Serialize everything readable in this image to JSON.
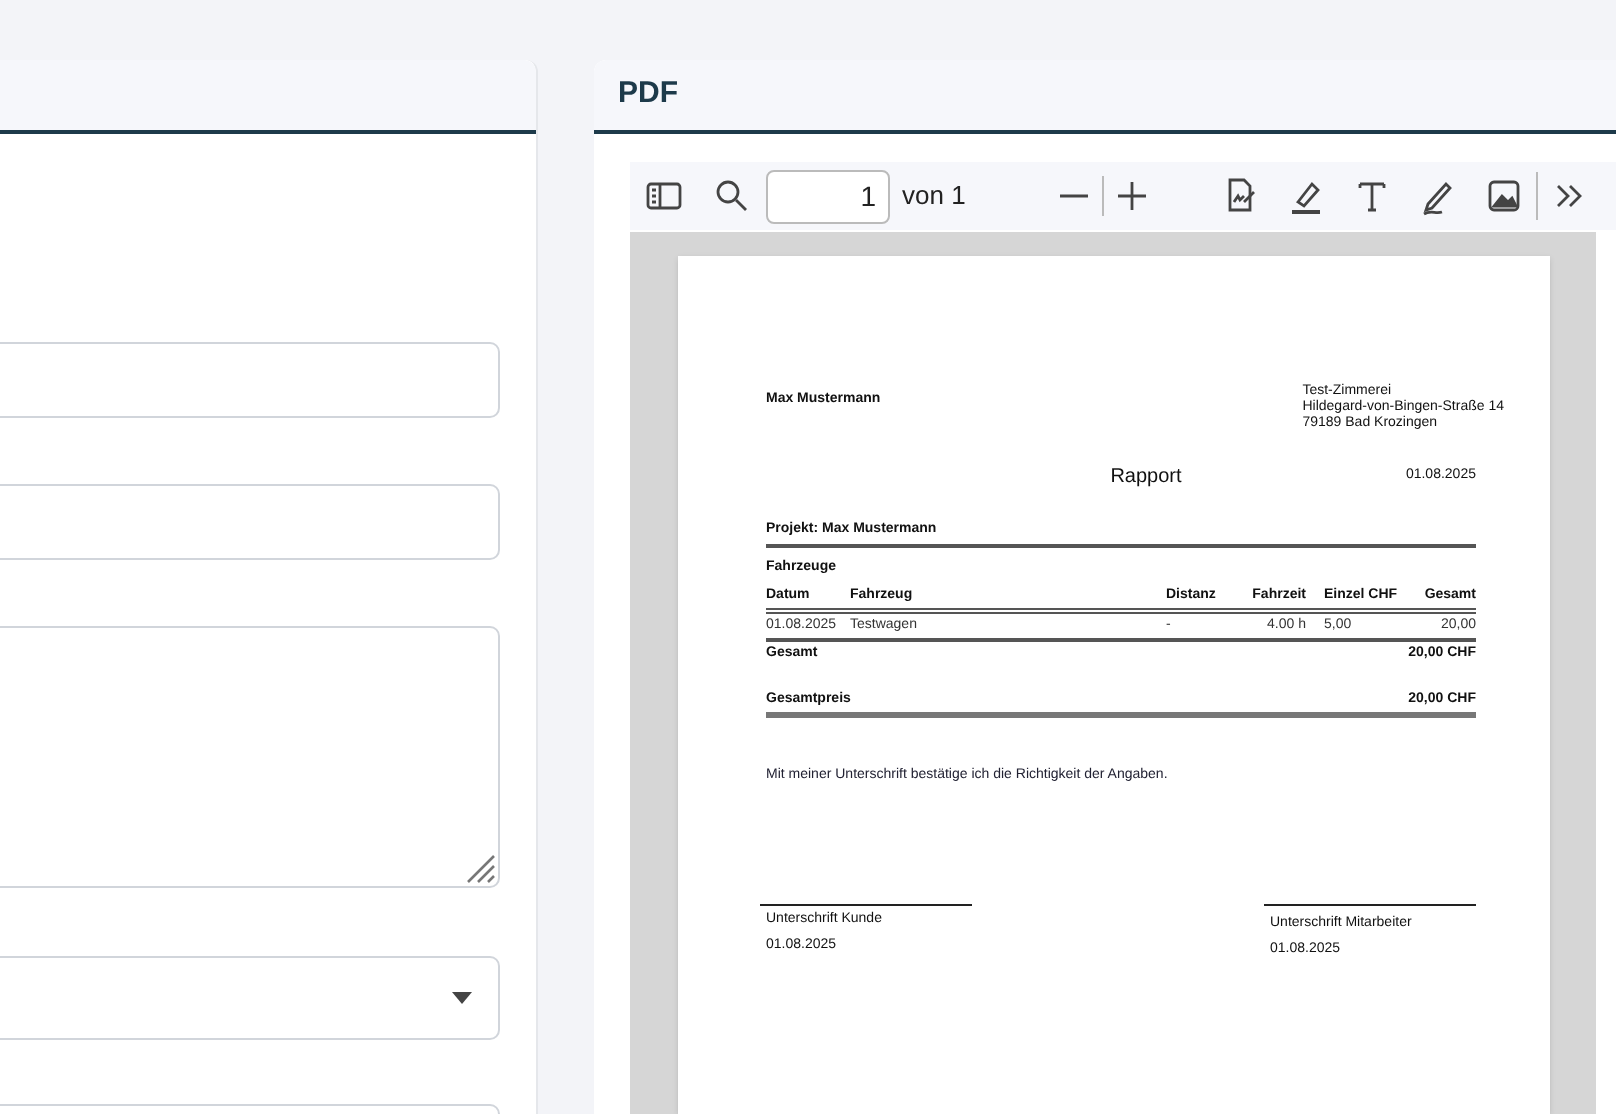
{
  "left_panel": {
    "fields": [
      {
        "kind": "input"
      },
      {
        "kind": "input"
      },
      {
        "kind": "textarea"
      },
      {
        "kind": "select"
      },
      {
        "kind": "input"
      }
    ]
  },
  "pdf_panel": {
    "title": "PDF",
    "toolbar": {
      "page_input": "1",
      "page_count": "von 1"
    },
    "document": {
      "sender": "Max Mustermann",
      "company_lines": [
        "Test-Zimmerei",
        "Hildegard-von-Bingen-Straße 14",
        "79189 Bad Krozingen"
      ],
      "title": "Rapport",
      "date": "01.08.2025",
      "project": "Projekt: Max Mustermann",
      "section": "Fahrzeuge",
      "columns": [
        "Datum",
        "Fahrzeug",
        "Distanz",
        "Fahrzeit",
        "Einzel CHF",
        "Gesamt"
      ],
      "rows": [
        [
          "01.08.2025",
          "Testwagen",
          "-",
          "4.00 h",
          "5,00",
          "20,00"
        ]
      ],
      "total_label": "Gesamt",
      "total_value": "20,00 CHF",
      "grand_total_label": "Gesamtpreis",
      "grand_total_value": "20,00 CHF",
      "statement": "Mit meiner Unterschrift bestätige ich die Richtigkeit der Angaben.",
      "signatures": [
        {
          "label": "Unterschrift Kunde",
          "date": "01.08.2025"
        },
        {
          "label": "Unterschrift Mitarbeiter",
          "date": "01.08.2025"
        }
      ]
    }
  }
}
